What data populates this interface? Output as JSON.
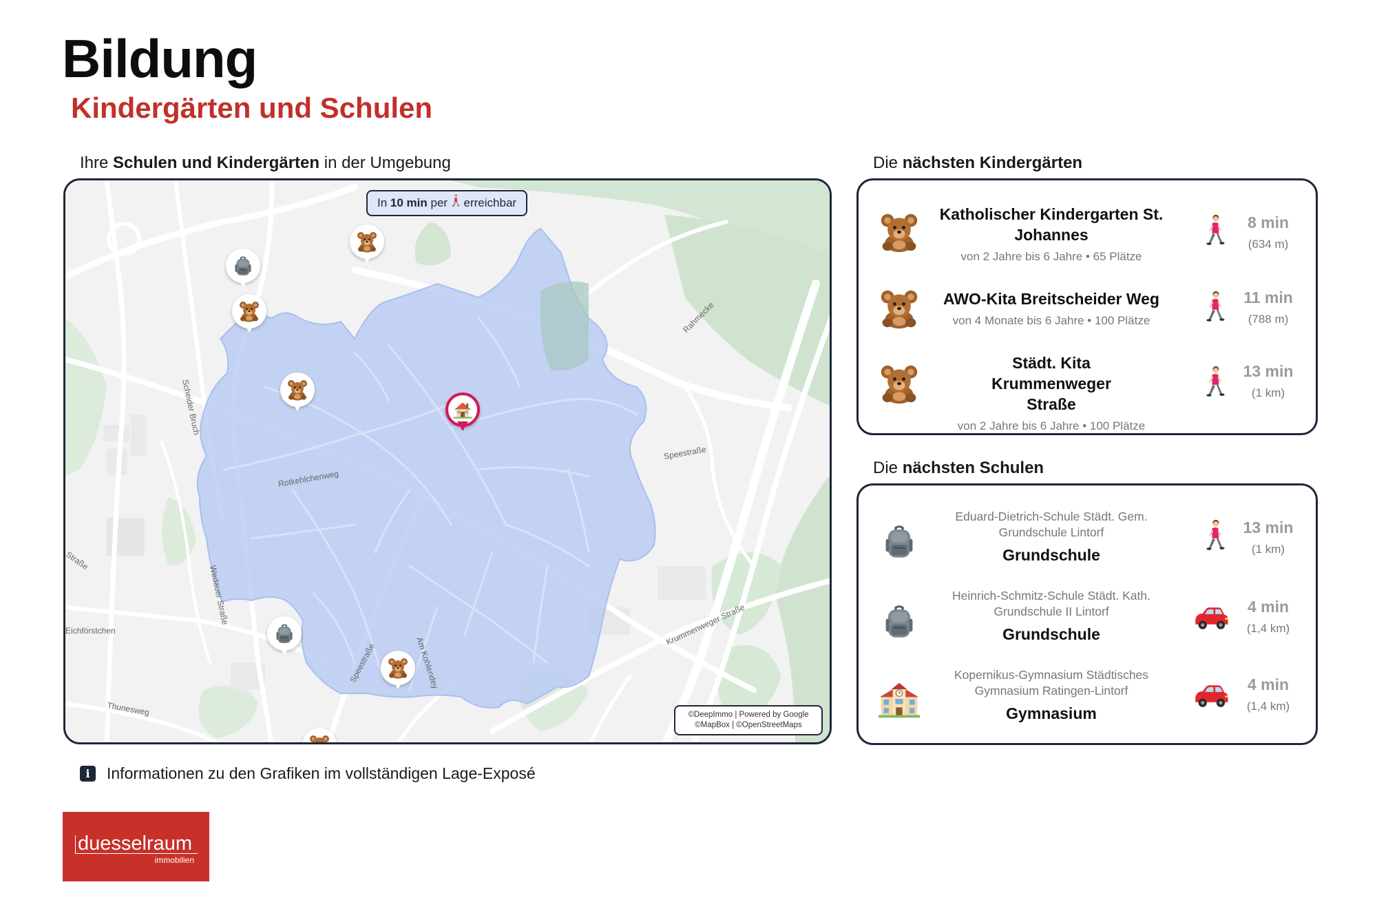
{
  "header": {
    "title": "Bildung",
    "subtitle": "Kindergärten und Schulen"
  },
  "map_section": {
    "label_pre": "Ihre ",
    "label_bold": "Schulen und Kindergärten",
    "label_post": " in der Umgebung",
    "badge_pre": "In ",
    "badge_bold": "10 min",
    "badge_post_a": " per ",
    "badge_post_b": " erreichbar",
    "attribution_line1": "©DeepImmo | Powered by Google",
    "attribution_line2": "©MapBox | ©OpenStreetMaps",
    "street_labels": [
      "Rotkehlchenweg",
      "Speestraße",
      "Scheider Bruch",
      "Wedauer Straße",
      "Krummenweger Straße",
      "Eichförstchen",
      "Thunesweg",
      "Am Kohlendey",
      "Speestraße",
      "Straße",
      "Rahmecke"
    ],
    "colors": {
      "isochrone": "#b8cbf2",
      "forest": "#cfe3cf",
      "home_pin": "#d4185a"
    }
  },
  "kindergartens": {
    "label_pre": "Die ",
    "label_bold": "nächsten Kindergärten",
    "items": [
      {
        "name": "Katholischer Kindergarten St. Johannes",
        "details": "von 2 Jahre bis 6 Jahre • 65 Plätze",
        "time": "8 min",
        "distance": "(634 m)",
        "mode": "walk-icon"
      },
      {
        "name": "AWO-Kita Breitscheider Weg",
        "details": "von 4 Monate bis 6 Jahre • 100 Plätze",
        "time": "11 min",
        "distance": "(788 m)",
        "mode": "walk-icon"
      },
      {
        "name": "Städt. Kita Krummenweger Straße",
        "details": "von 2 Jahre bis 6 Jahre • 100 Plätze",
        "time": "13 min",
        "distance": "(1 km)",
        "mode": "walk-icon"
      }
    ]
  },
  "schools": {
    "label_pre": "Die ",
    "label_bold": "nächsten Schulen",
    "items": [
      {
        "name": "Eduard-Dietrich-Schule Städt. Gem. Grundschule Lintorf",
        "type": "Grundschule",
        "time": "13 min",
        "distance": "(1 km)",
        "mode": "walk-icon",
        "icon": "backpack-icon"
      },
      {
        "name": "Heinrich-Schmitz-Schule Städt. Kath. Grundschule II Lintorf",
        "type": "Grundschule",
        "time": "4 min",
        "distance": "(1,4 km)",
        "mode": "car-icon",
        "icon": "backpack-icon"
      },
      {
        "name": "Kopernikus-Gymnasium Städtisches Gymnasium Ratingen-Lintorf",
        "type": "Gymnasium",
        "time": "4 min",
        "distance": "(1,4 km)",
        "mode": "car-icon",
        "icon": "school-building-icon"
      }
    ]
  },
  "footer": {
    "info_text": "Informationen zu den Grafiken im vollständigen Lage-Exposé",
    "info_icon_glyph": "i",
    "logo_main": "duesselraum",
    "logo_sub": "immobilien",
    "brand_color": "#c8302a"
  }
}
